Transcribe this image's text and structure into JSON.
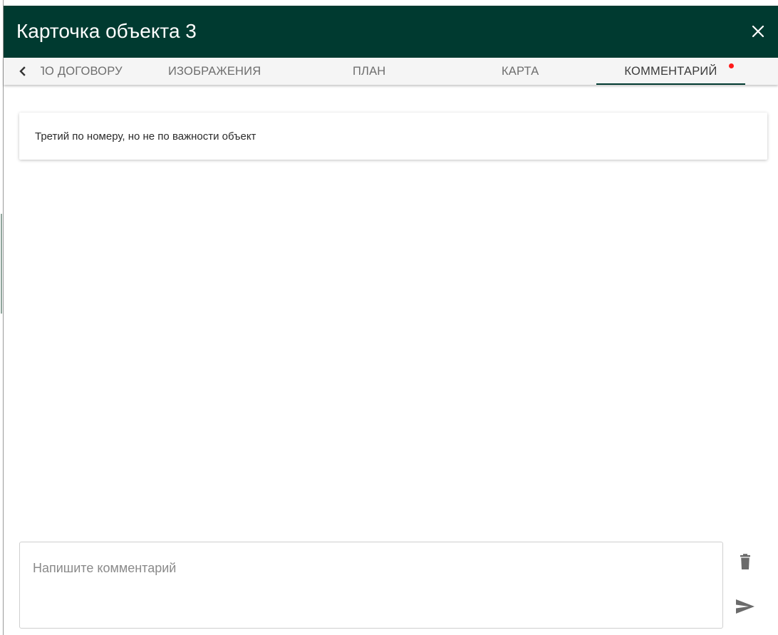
{
  "dialog": {
    "title": "Карточка объекта 3",
    "header_color": "#003a30",
    "close_icon": "close-icon"
  },
  "tabs": {
    "scroll_left_icon": "chevron-left-icon",
    "items": [
      {
        "label": "ПО ДОГОВОРУ",
        "active": false,
        "partially_hidden": true
      },
      {
        "label": "ИЗОБРАЖЕНИЯ",
        "active": false
      },
      {
        "label": "ПЛАН",
        "active": false
      },
      {
        "label": "КАРТА",
        "active": false
      },
      {
        "label": "КОММЕНТАРИЙ",
        "active": true,
        "has_notification_dot": true
      }
    ],
    "active_indicator_color": "#003a30",
    "notification_dot_color": "#ff1a1a"
  },
  "comments": [
    {
      "text": "Третий по номеру, но не по важности объект"
    }
  ],
  "composer": {
    "value": "",
    "placeholder": "Напишите комментарий",
    "delete_icon": "trash-icon",
    "send_icon": "send-icon"
  }
}
